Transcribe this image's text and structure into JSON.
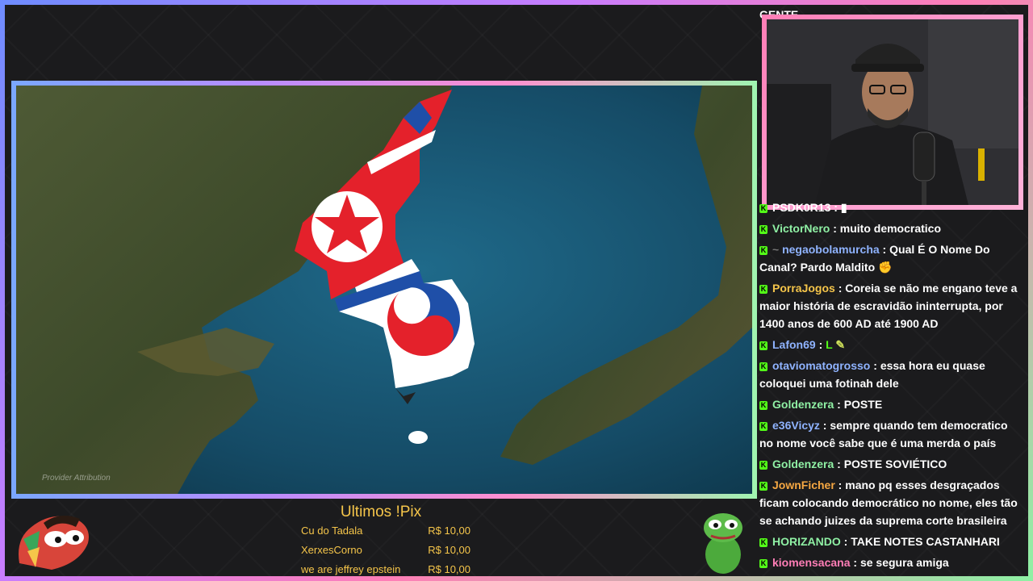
{
  "overlay": {
    "top_chat_fragment": "GENTE",
    "map_attribution": "Provider Attribution"
  },
  "chat": {
    "messages": [
      {
        "user": "PSDK0R13",
        "text": "",
        "color": "#ffffff"
      },
      {
        "user": "VictorNero",
        "text": "muito democratico",
        "color": "#8ff0a4"
      },
      {
        "user": "negaobolamurcha",
        "text": "Qual É O Nome Do Canal? Pardo Maldito",
        "color": "#8fb3ff"
      },
      {
        "user": "PorraJogos",
        "text": "Coreia se não me engano teve a maior história de escravidão ininterrupta, por 1400 anos de 600 AD até 1900 AD",
        "color": "#f5c54a"
      },
      {
        "user": "Lafon69",
        "text": "",
        "color": "#8fb3ff"
      },
      {
        "user": "otaviomatogrosso",
        "text": "essa hora eu quase coloquei uma fotinah dele",
        "color": "#8fb3ff"
      },
      {
        "user": "Goldenzera",
        "text": "POSTE",
        "color": "#8ff0a4"
      },
      {
        "user": "e36Vicyz",
        "text": "sempre quando tem democratico no nome você sabe que é uma merda o país",
        "color": "#8fb3ff"
      },
      {
        "user": "Goldenzera",
        "text": "POSTE SOVIÉTICO",
        "color": "#8ff0a4"
      },
      {
        "user": "JownFicher",
        "text": "mano pq esses desgraçados ficam colocando democrático no nome, eles tão se achando juizes da suprema corte brasileira",
        "color": "#f5a742"
      },
      {
        "user": "HORIZANDO",
        "text": "TAKE NOTES CASTANHARI",
        "color": "#8ff0a4"
      },
      {
        "user": "kiomensacana",
        "text": "se segura amiga",
        "color": "#ff7eb6"
      }
    ]
  },
  "pix": {
    "title": "Ultimos !Pix",
    "rows": [
      {
        "name": "Cu do Tadala",
        "amount": "R$ 10,00"
      },
      {
        "name": "XerxesCorno",
        "amount": "R$ 10,00"
      },
      {
        "name": "we are jeffrey epstein",
        "amount": "R$ 10,00"
      }
    ]
  },
  "colors": {
    "pix_text": "#f5c54a",
    "kick_green": "#53fc18",
    "nk_red": "#e4212b",
    "sk_blue": "#1f4fa8"
  }
}
